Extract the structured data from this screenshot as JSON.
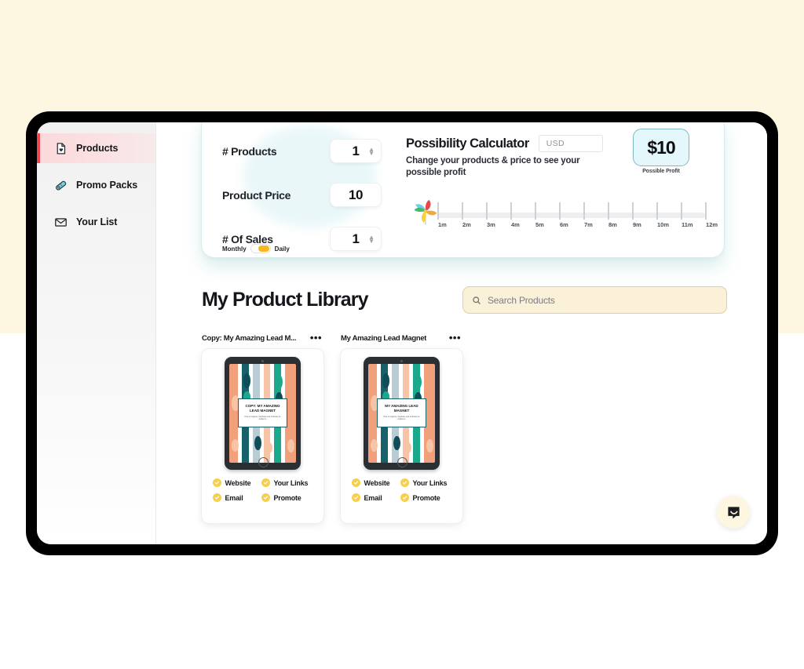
{
  "sidebar": {
    "items": [
      {
        "label": "Products",
        "icon": "document-heart-icon",
        "active": true
      },
      {
        "label": "Promo Packs",
        "icon": "ticket-icon",
        "active": false
      },
      {
        "label": "Your List",
        "icon": "envelope-icon",
        "active": false
      }
    ]
  },
  "calculator": {
    "title": "Possibility Calculator",
    "subtitle": "Change your products & price to see your possible profit",
    "currency": "USD",
    "profit_value": "$10",
    "profit_caption": "Possible Profit",
    "fields": [
      {
        "label": "# Products",
        "value": "1",
        "has_spinner": true
      },
      {
        "label": "Product Price",
        "value": "10",
        "has_spinner": false
      },
      {
        "label": "# Of Sales",
        "value": "1",
        "has_spinner": true
      }
    ],
    "frequency_toggle": {
      "left_label": "Monthly",
      "right_label": "Daily",
      "selected": "Daily"
    },
    "timeline": {
      "icon": "pinwheel-icon",
      "ticks": [
        "1m",
        "2m",
        "3m",
        "4m",
        "5m",
        "6m",
        "7m",
        "8m",
        "9m",
        "10m",
        "11m",
        "12m"
      ]
    }
  },
  "library": {
    "title": "My Product Library",
    "search": {
      "placeholder": "Search Products",
      "icon": "search-icon",
      "value": ""
    },
    "products": [
      {
        "name": "Copy: My Amazing Lead M...",
        "menu": "•••",
        "cover_title": "COPY: MY AMAZING LEAD MAGNET",
        "cover_subtitle": "How to Capture, Captivate and Cultivate an Audience",
        "badges": [
          "Website",
          "Your Links",
          "Email",
          "Promote"
        ]
      },
      {
        "name": "My Amazing Lead Magnet",
        "menu": "•••",
        "cover_title": "MY AMAZING LEAD MAGNET",
        "cover_subtitle": "How to Capture, Captivate and Cultivate an Audience",
        "badges": [
          "Website",
          "Your Links",
          "Email",
          "Promote"
        ]
      }
    ]
  },
  "chat": {
    "icon": "chat-bubble-icon"
  },
  "colors": {
    "page_background": "#FDF6E1",
    "accent_red": "#f0474f",
    "badge_yellow": "#f7cf4e",
    "profit_mint": "#e4f7fa",
    "search_cream": "#fbf1d9"
  }
}
